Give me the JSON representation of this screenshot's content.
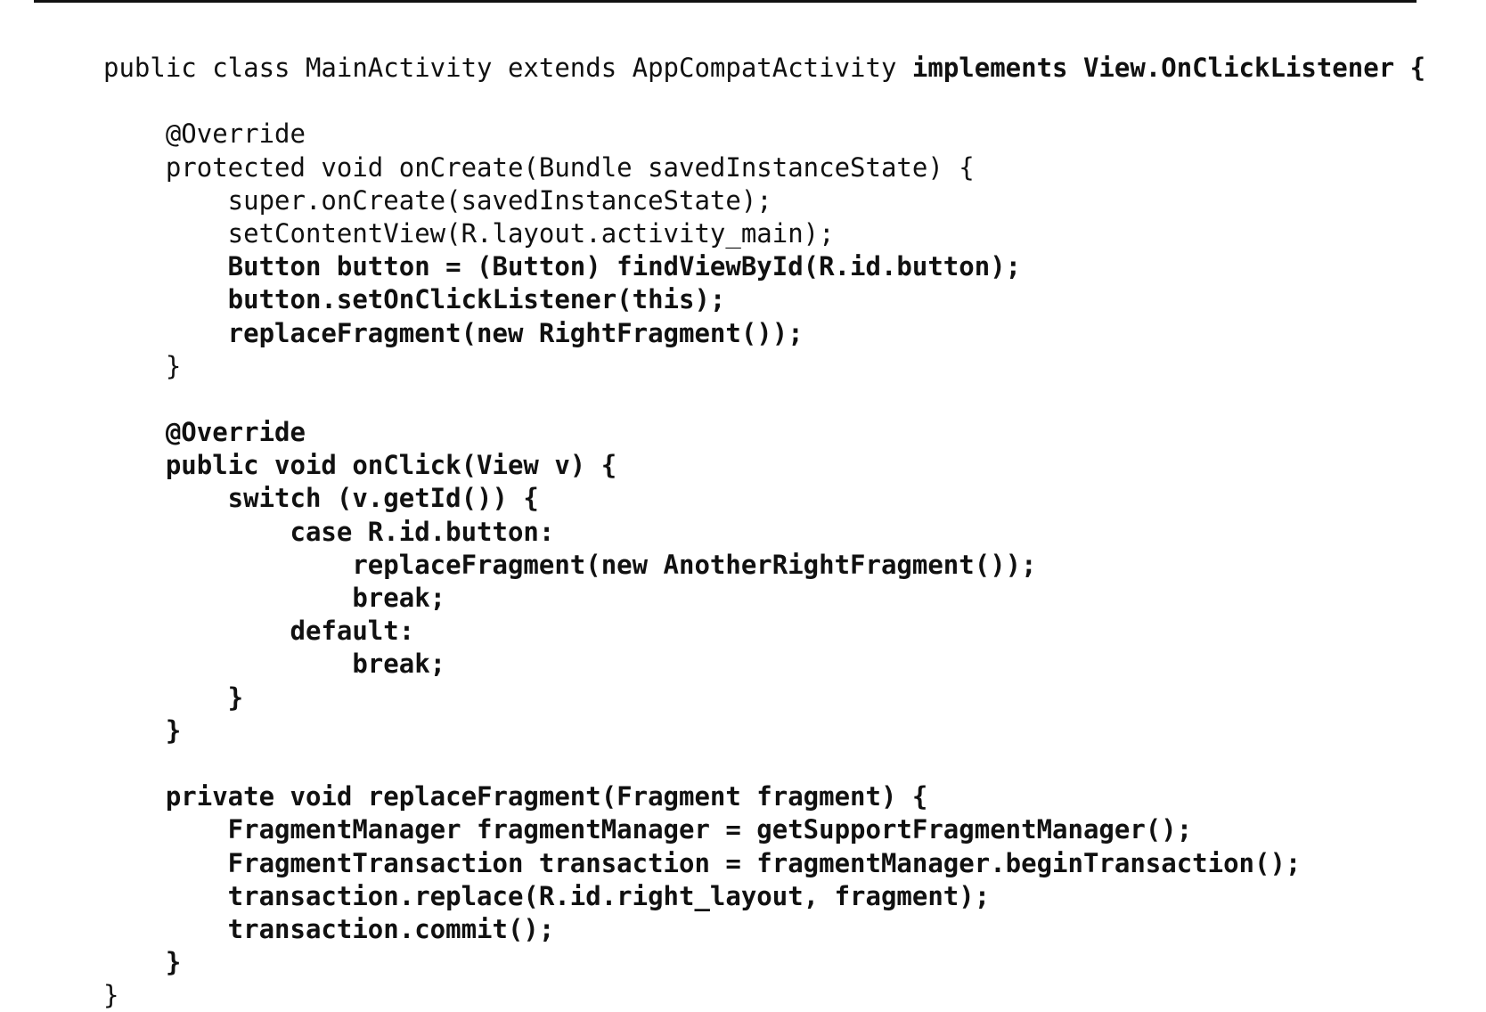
{
  "document": {
    "lines": [
      {
        "segments": [
          {
            "text": "public class MainActivity extends AppCompatActivity ",
            "bold": false
          },
          {
            "text": "implements View.OnClickListener {",
            "bold": true
          }
        ]
      },
      {
        "segments": []
      },
      {
        "segments": [
          {
            "text": "    @Override",
            "bold": false
          }
        ]
      },
      {
        "segments": [
          {
            "text": "    protected void onCreate(Bundle savedInstanceState) {",
            "bold": false
          }
        ]
      },
      {
        "segments": [
          {
            "text": "        super.onCreate(savedInstanceState);",
            "bold": false
          }
        ]
      },
      {
        "segments": [
          {
            "text": "        setContentView(R.layout.activity_main);",
            "bold": false
          }
        ]
      },
      {
        "segments": [
          {
            "text": "        Button button = (Button) findViewById(R.id.button);",
            "bold": true
          }
        ]
      },
      {
        "segments": [
          {
            "text": "        button.setOnClickListener(this);",
            "bold": true
          }
        ]
      },
      {
        "segments": [
          {
            "text": "        replaceFragment(new RightFragment());",
            "bold": true
          }
        ]
      },
      {
        "segments": [
          {
            "text": "    }",
            "bold": false
          }
        ]
      },
      {
        "segments": []
      },
      {
        "segments": [
          {
            "text": "    @Override",
            "bold": true
          }
        ]
      },
      {
        "segments": [
          {
            "text": "    public void onClick(View v) {",
            "bold": true
          }
        ]
      },
      {
        "segments": [
          {
            "text": "        switch (v.getId()) {",
            "bold": true
          }
        ]
      },
      {
        "segments": [
          {
            "text": "            case R.id.button:",
            "bold": true
          }
        ]
      },
      {
        "segments": [
          {
            "text": "                replaceFragment(new AnotherRightFragment());",
            "bold": true
          }
        ]
      },
      {
        "segments": [
          {
            "text": "                break;",
            "bold": true
          }
        ]
      },
      {
        "segments": [
          {
            "text": "            default:",
            "bold": true
          }
        ]
      },
      {
        "segments": [
          {
            "text": "                break;",
            "bold": true
          }
        ]
      },
      {
        "segments": [
          {
            "text": "        }",
            "bold": true
          }
        ]
      },
      {
        "segments": [
          {
            "text": "    }",
            "bold": true
          }
        ]
      },
      {
        "segments": []
      },
      {
        "segments": [
          {
            "text": "    private void replaceFragment(Fragment fragment) {",
            "bold": true
          }
        ]
      },
      {
        "segments": [
          {
            "text": "        FragmentManager fragmentManager = getSupportFragmentManager();",
            "bold": true
          }
        ]
      },
      {
        "segments": [
          {
            "text": "        FragmentTransaction transaction = fragmentManager.beginTransaction();",
            "bold": true
          }
        ]
      },
      {
        "segments": [
          {
            "text": "        transaction.replace(R.id.right_layout, fragment);",
            "bold": true
          }
        ]
      },
      {
        "segments": [
          {
            "text": "        transaction.commit();",
            "bold": true
          }
        ]
      },
      {
        "segments": [
          {
            "text": "    }",
            "bold": true
          }
        ]
      },
      {
        "segments": [
          {
            "text": "}",
            "bold": false
          }
        ]
      }
    ]
  }
}
